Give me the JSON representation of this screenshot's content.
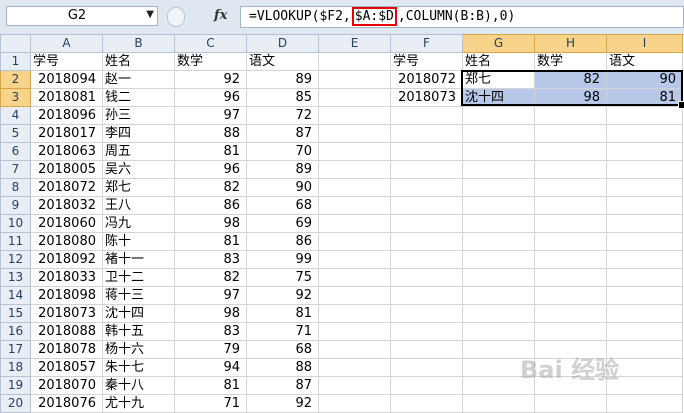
{
  "formula_bar": {
    "name_box": "G2",
    "fx_label": "fx",
    "formula_prefix": "=VLOOKUP($F2,",
    "formula_highlight": "$A:$D",
    "formula_suffix": ",COLUMN(B:B),0)"
  },
  "columns": [
    "A",
    "B",
    "C",
    "D",
    "E",
    "F",
    "G",
    "H",
    "I"
  ],
  "rows": [
    [
      "学号",
      "姓名",
      "数学",
      "语文",
      "",
      "学号",
      "姓名",
      "数学",
      "语文"
    ],
    [
      "2018094",
      "赵一",
      "92",
      "89",
      "",
      "2018072",
      "郑七",
      "82",
      "90"
    ],
    [
      "2018081",
      "钱二",
      "96",
      "85",
      "",
      "2018073",
      "沈十四",
      "98",
      "81"
    ],
    [
      "2018096",
      "孙三",
      "97",
      "72",
      "",
      "",
      "",
      "",
      ""
    ],
    [
      "2018017",
      "李四",
      "88",
      "87",
      "",
      "",
      "",
      "",
      ""
    ],
    [
      "2018063",
      "周五",
      "81",
      "70",
      "",
      "",
      "",
      "",
      ""
    ],
    [
      "2018005",
      "吴六",
      "96",
      "89",
      "",
      "",
      "",
      "",
      ""
    ],
    [
      "2018072",
      "郑七",
      "82",
      "90",
      "",
      "",
      "",
      "",
      ""
    ],
    [
      "2018032",
      "王八",
      "86",
      "68",
      "",
      "",
      "",
      "",
      ""
    ],
    [
      "2018060",
      "冯九",
      "98",
      "69",
      "",
      "",
      "",
      "",
      ""
    ],
    [
      "2018080",
      "陈十",
      "81",
      "86",
      "",
      "",
      "",
      "",
      ""
    ],
    [
      "2018092",
      "褚十一",
      "83",
      "99",
      "",
      "",
      "",
      "",
      ""
    ],
    [
      "2018033",
      "卫十二",
      "82",
      "75",
      "",
      "",
      "",
      "",
      ""
    ],
    [
      "2018098",
      "蒋十三",
      "97",
      "92",
      "",
      "",
      "",
      "",
      ""
    ],
    [
      "2018073",
      "沈十四",
      "98",
      "81",
      "",
      "",
      "",
      "",
      ""
    ],
    [
      "2018088",
      "韩十五",
      "83",
      "71",
      "",
      "",
      "",
      "",
      ""
    ],
    [
      "2018078",
      "杨十六",
      "79",
      "68",
      "",
      "",
      "",
      "",
      ""
    ],
    [
      "2018057",
      "朱十七",
      "94",
      "88",
      "",
      "",
      "",
      "",
      ""
    ],
    [
      "2018070",
      "秦十八",
      "81",
      "87",
      "",
      "",
      "",
      "",
      ""
    ],
    [
      "2018076",
      "尤十九",
      "71",
      "92",
      "",
      "",
      "",
      "",
      ""
    ]
  ],
  "watermark": "Bai 经验",
  "colors": {
    "highlight_border": "#e8000b",
    "selection_fill": "#b7c8e8",
    "selected_header": "#f8d48b"
  }
}
